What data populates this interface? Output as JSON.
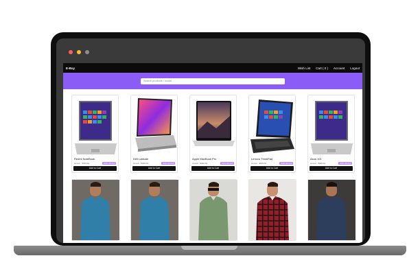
{
  "nav": {
    "brand": "E-Buy",
    "links": [
      "Wish List",
      "Cart ( 0 )",
      "Account",
      "Logout"
    ]
  },
  "search": {
    "placeholder": "Search products / model"
  },
  "products": [
    {
      "name": "Redmi NoteBook",
      "price": "Amount : 45000 Rs.",
      "badge": "VIEW DETAILS",
      "button": "Add to Cart"
    },
    {
      "name": "Dell Latitude",
      "price": "Amount : 55000 Rs.",
      "badge": "VIEW DETAILS",
      "button": "Add to Cart"
    },
    {
      "name": "Apple MacBook Pro",
      "price": "Amount : 99000 Rs.",
      "badge": "VIEW DETAILS",
      "button": "Add to Cart"
    },
    {
      "name": "Lenovo ThinkPad",
      "price": "Amount : 48000 Rs.",
      "badge": "VIEW DETAILS",
      "button": "Add to Cart"
    },
    {
      "name": "Asus 101",
      "price": "Amount : 35000 Rs.",
      "badge": "VIEW DETAILS",
      "button": "Add to Cart"
    }
  ],
  "colors": {
    "banner": "#8c5cf6",
    "nav": "#0b0b0b",
    "badge": "#c08bff"
  }
}
